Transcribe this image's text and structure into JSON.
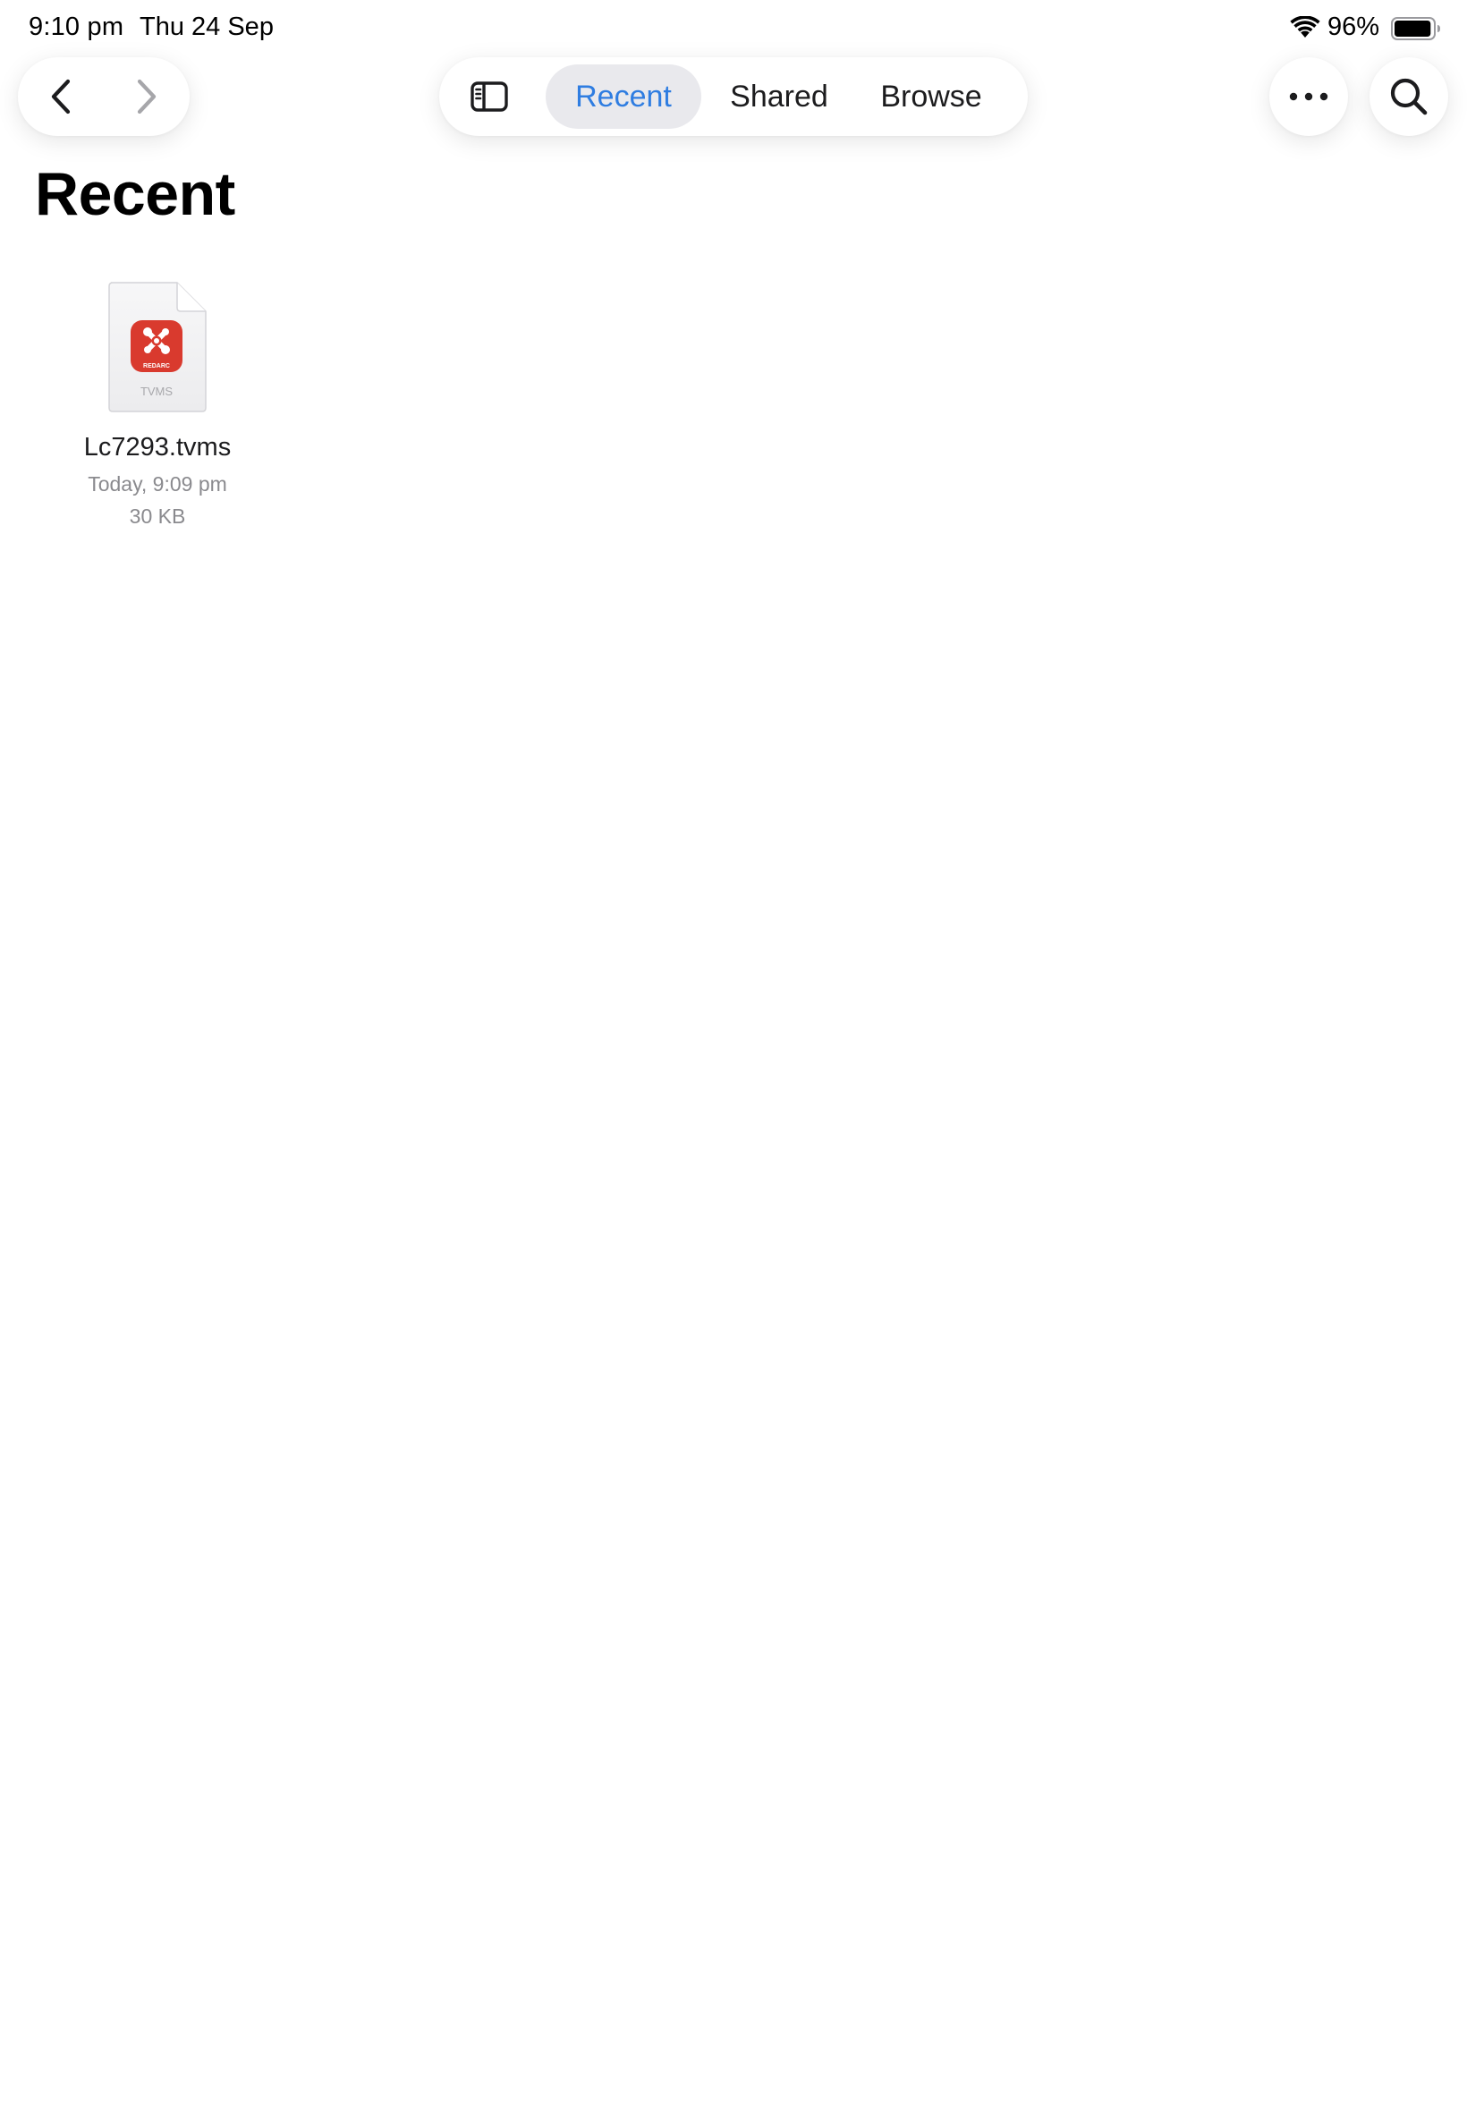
{
  "status_bar": {
    "time": "9:10 pm",
    "date": "Thu 24 Sep",
    "battery_percent": "96%",
    "battery_level": 0.96,
    "wifi_icon": "wifi-icon",
    "battery_icon": "battery-icon"
  },
  "toolbar": {
    "back_icon": "chevron-left-icon",
    "forward_icon": "chevron-right-icon",
    "sidebar_icon": "sidebar-icon",
    "more_icon": "ellipsis-icon",
    "search_icon": "magnifier-icon",
    "tabs": [
      {
        "label": "Recent",
        "selected": true
      },
      {
        "label": "Shared",
        "selected": false
      },
      {
        "label": "Browse",
        "selected": false
      }
    ]
  },
  "main": {
    "title": "Recent",
    "files": [
      {
        "name": "Lc7293.tvms",
        "modified": "Today, 9:09 pm",
        "size": "30 KB",
        "thumbnail": {
          "app_logo_text": "REDARC",
          "type_label": "TVMS",
          "icon": "redarc-app-icon"
        }
      }
    ]
  },
  "colors": {
    "accent": "#2f7de1",
    "selected_tab_bg": "#e9e9ed",
    "secondary_text": "#8a8a8e",
    "app_icon_red": "#d93a2e"
  }
}
